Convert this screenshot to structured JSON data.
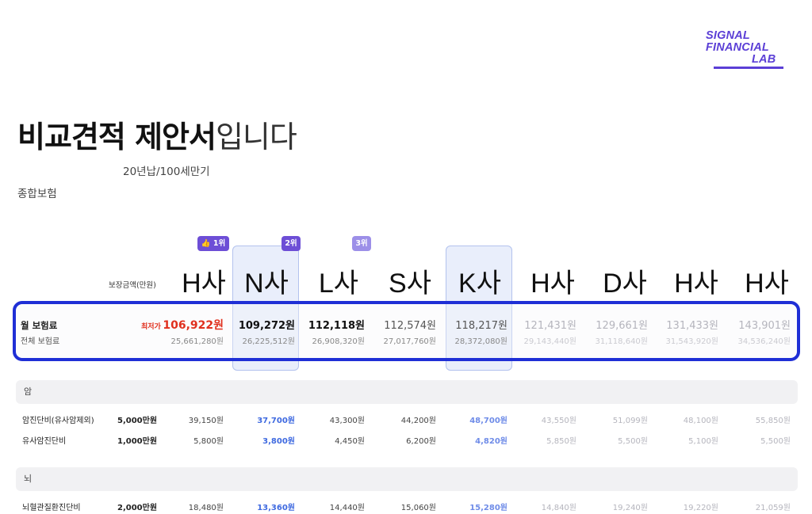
{
  "logo": {
    "line1": "SIGNAL",
    "line2": "FINANCIAL",
    "line3": "LAB"
  },
  "title": {
    "bold": "비교견적 제안서",
    "light": "입니다"
  },
  "subtitle": "20년납/100세만기",
  "category": "종합보험",
  "coverage_label": "보장금액(만원)",
  "badges": {
    "first": "👍 1위",
    "second": "2위",
    "third": "3위"
  },
  "companies": [
    "H사",
    "N사",
    "L사",
    "S사",
    "K사",
    "H사",
    "D사",
    "H사",
    "H사"
  ],
  "premium": {
    "label": "월 보험료",
    "sub_label": "전체 보험료",
    "lowest_tag": "최저가",
    "monthly": [
      "106,922원",
      "109,272원",
      "112,118원",
      "112,574원",
      "118,217원",
      "121,431원",
      "129,661원",
      "131,433원",
      "143,901원"
    ],
    "total": [
      "25,661,280원",
      "26,225,512원",
      "26,908,320원",
      "27,017,760원",
      "28,372,080원",
      "29,143,440원",
      "31,118,640원",
      "31,543,920원",
      "34,536,240원"
    ]
  },
  "sections": [
    {
      "name": "암",
      "rows": [
        {
          "label": "암진단비(유사암제외)",
          "coverage": "5,000만원",
          "values": [
            "39,150원",
            "37,700원",
            "43,300원",
            "44,200원",
            "48,700원",
            "43,550원",
            "51,099원",
            "48,100원",
            "55,850원"
          ]
        },
        {
          "label": "유사암진단비",
          "coverage": "1,000만원",
          "values": [
            "5,800원",
            "3,800원",
            "4,450원",
            "6,200원",
            "4,820원",
            "5,850원",
            "5,500원",
            "5,100원",
            "5,500원"
          ]
        }
      ]
    },
    {
      "name": "뇌",
      "rows": [
        {
          "label": "뇌혈관질환진단비",
          "coverage": "2,000만원",
          "values": [
            "18,480원",
            "13,360원",
            "14,440원",
            "15,060원",
            "15,280원",
            "14,840원",
            "19,240원",
            "19,220원",
            "21,059원"
          ]
        }
      ]
    }
  ],
  "colors": {
    "accent": "#5b3fd6",
    "highlight_border": "#1f2fd6",
    "lowest": "#e0301e",
    "blue_value": "#3f6ae0"
  }
}
